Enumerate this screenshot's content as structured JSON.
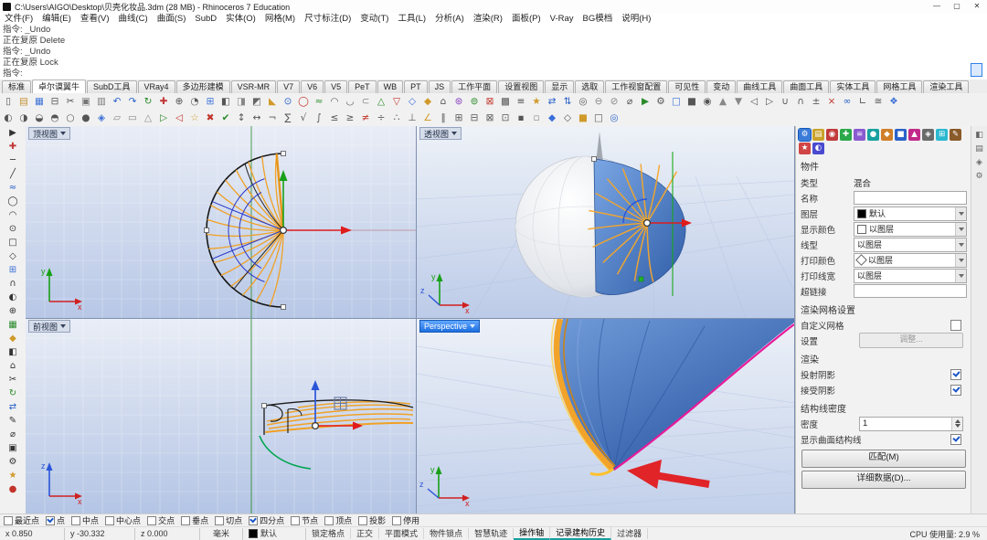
{
  "window": {
    "title": "C:\\Users\\AIGO\\Desktop\\贝壳化妆品.3dm (28 MB) - Rhinoceros 7 Education",
    "controls": {
      "minimize": "—",
      "maximize": "▢",
      "close": "✕"
    }
  },
  "menu": {
    "items": [
      "文件(F)",
      "编辑(E)",
      "查看(V)",
      "曲线(C)",
      "曲面(S)",
      "SubD",
      "实体(O)",
      "网格(M)",
      "尺寸标注(D)",
      "变动(T)",
      "工具(L)",
      "分析(A)",
      "渲染(R)",
      "面板(P)",
      "V-Ray",
      "BG模档",
      "说明(H)"
    ]
  },
  "command": {
    "lines": [
      "指令: _Undo",
      "正在复原 Delete",
      "指令: _Undo",
      "正在复原 Lock",
      "指令:"
    ]
  },
  "tabs": {
    "items": [
      {
        "label": "标准"
      },
      {
        "label": "卓尔谟翼牛",
        "active": true
      },
      {
        "label": "SubD工具"
      },
      {
        "label": "VRay4"
      },
      {
        "label": "多边形建模"
      },
      {
        "label": "VSR-MR"
      },
      {
        "label": "V7"
      },
      {
        "label": "V6"
      },
      {
        "label": "V5"
      },
      {
        "label": "PeT"
      },
      {
        "label": "WB"
      },
      {
        "label": "PT"
      },
      {
        "label": "JS"
      },
      {
        "label": "工作平面"
      },
      {
        "label": "设置视图"
      },
      {
        "label": "显示"
      },
      {
        "label": "选取"
      },
      {
        "label": "工作视窗配置"
      },
      {
        "label": "可见性"
      },
      {
        "label": "变动"
      },
      {
        "label": "曲线工具"
      },
      {
        "label": "曲面工具"
      },
      {
        "label": "实体工具"
      },
      {
        "label": "网格工具"
      },
      {
        "label": "渲染工具"
      }
    ]
  },
  "toolbar": {
    "row1": [
      {
        "g": "▯",
        "c": "#555"
      },
      {
        "g": "▤",
        "c": "#c08a2a"
      },
      {
        "g": "▦",
        "c": "#3a6fd8"
      },
      {
        "g": "⊟",
        "c": "#555"
      },
      {
        "g": "✂",
        "c": "#555"
      },
      {
        "g": "▣",
        "c": "#777"
      },
      {
        "g": "▥",
        "c": "#777"
      },
      {
        "g": "↶",
        "c": "#2a62c9"
      },
      {
        "g": "↷",
        "c": "#2a62c9"
      },
      {
        "g": "↻",
        "c": "#2a8a2a"
      },
      {
        "g": "✚",
        "c": "#c23a3a"
      },
      {
        "g": "⊕",
        "c": "#555"
      },
      {
        "g": "◔",
        "c": "#555"
      },
      {
        "g": "⊞",
        "c": "#3a6fd8"
      },
      {
        "g": "◧",
        "c": "#555"
      },
      {
        "g": "◨",
        "c": "#888"
      },
      {
        "g": "◩",
        "c": "#666"
      },
      {
        "g": "◣",
        "c": "#d09a2a"
      },
      {
        "g": "⊙",
        "c": "#2a62c9"
      },
      {
        "g": "◯",
        "c": "#c2342a"
      },
      {
        "g": "≈",
        "c": "#2a8a2a"
      },
      {
        "g": "◠",
        "c": "#555"
      },
      {
        "g": "◡",
        "c": "#555"
      },
      {
        "g": "⊂",
        "c": "#888"
      },
      {
        "g": "△",
        "c": "#2a8a2a"
      },
      {
        "g": "▽",
        "c": "#c2342a"
      },
      {
        "g": "◇",
        "c": "#3a6fd8"
      },
      {
        "g": "◆",
        "c": "#d09a2a"
      },
      {
        "g": "⌂",
        "c": "#555"
      },
      {
        "g": "⊛",
        "c": "#8a44c0"
      },
      {
        "g": "⊚",
        "c": "#2a8a2a"
      },
      {
        "g": "⊠",
        "c": "#c2342a"
      },
      {
        "g": "▩",
        "c": "#555"
      },
      {
        "g": "≡",
        "c": "#555"
      },
      {
        "g": "★",
        "c": "#d09a2a"
      },
      {
        "g": "⇄",
        "c": "#2a62c9"
      },
      {
        "g": "⇅",
        "c": "#2a62c9"
      },
      {
        "g": "◎",
        "c": "#555"
      },
      {
        "g": "⊖",
        "c": "#888"
      },
      {
        "g": "⊘",
        "c": "#888"
      },
      {
        "g": "⌀",
        "c": "#555"
      },
      {
        "g": "▶",
        "c": "#2a8a2a"
      },
      {
        "g": "⚙",
        "c": "#555"
      },
      {
        "g": "□",
        "c": "#3a6fd8"
      },
      {
        "g": "■",
        "c": "#555"
      },
      {
        "g": "◉",
        "c": "#555"
      },
      {
        "g": "▲",
        "c": "#888"
      },
      {
        "g": "▼",
        "c": "#888"
      },
      {
        "g": "◁",
        "c": "#555"
      },
      {
        "g": "▷",
        "c": "#555"
      },
      {
        "g": "∪",
        "c": "#555"
      },
      {
        "g": "∩",
        "c": "#555"
      },
      {
        "g": "±",
        "c": "#555"
      },
      {
        "g": "×",
        "c": "#c2342a"
      },
      {
        "g": "∞",
        "c": "#2a62c9"
      },
      {
        "g": "∟",
        "c": "#555"
      },
      {
        "g": "≅",
        "c": "#555"
      },
      {
        "g": "❖",
        "c": "#3a6fd8"
      }
    ],
    "row2": [
      {
        "g": "◐",
        "c": "#555"
      },
      {
        "g": "◑",
        "c": "#555"
      },
      {
        "g": "◒",
        "c": "#555"
      },
      {
        "g": "◓",
        "c": "#555"
      },
      {
        "g": "○",
        "c": "#555"
      },
      {
        "g": "●",
        "c": "#555"
      },
      {
        "g": "◈",
        "c": "#3a6fd8"
      },
      {
        "g": "▱",
        "c": "#888"
      },
      {
        "g": "▭",
        "c": "#888"
      },
      {
        "g": "△",
        "c": "#888"
      },
      {
        "g": "▷",
        "c": "#2a8a2a"
      },
      {
        "g": "◁",
        "c": "#c2342a"
      },
      {
        "g": "☆",
        "c": "#d09a2a"
      },
      {
        "g": "✖",
        "c": "#c2342a"
      },
      {
        "g": "✔",
        "c": "#2a8a2a"
      },
      {
        "g": "↕",
        "c": "#555"
      },
      {
        "g": "↔",
        "c": "#555"
      },
      {
        "g": "¬",
        "c": "#555"
      },
      {
        "g": "∑",
        "c": "#555"
      },
      {
        "g": "√",
        "c": "#555"
      },
      {
        "g": "∫",
        "c": "#555"
      },
      {
        "g": "≤",
        "c": "#555"
      },
      {
        "g": "≥",
        "c": "#555"
      },
      {
        "g": "≠",
        "c": "#c2342a"
      },
      {
        "g": "÷",
        "c": "#555"
      },
      {
        "g": "∴",
        "c": "#555"
      },
      {
        "g": "⊥",
        "c": "#555"
      },
      {
        "g": "∠",
        "c": "#d09a2a"
      },
      {
        "g": "∥",
        "c": "#555"
      },
      {
        "g": "⊞",
        "c": "#555"
      },
      {
        "g": "⊟",
        "c": "#555"
      },
      {
        "g": "⊠",
        "c": "#555"
      },
      {
        "g": "⊡",
        "c": "#555"
      },
      {
        "g": "▪",
        "c": "#555"
      },
      {
        "g": "▫",
        "c": "#888"
      },
      {
        "g": "◆",
        "c": "#3a6fd8"
      },
      {
        "g": "◇",
        "c": "#555"
      },
      {
        "g": "■",
        "c": "#d09a2a"
      },
      {
        "g": "□",
        "c": "#555"
      },
      {
        "g": "◎",
        "c": "#2a62c9"
      }
    ]
  },
  "leftbar": {
    "icons": [
      {
        "g": "▶",
        "c": "#333"
      },
      {
        "g": "✚",
        "c": "#c23a3a"
      },
      {
        "g": "─",
        "c": "#333"
      },
      {
        "g": "╱",
        "c": "#333"
      },
      {
        "g": "≈",
        "c": "#2a62c9"
      },
      {
        "g": "◯",
        "c": "#333"
      },
      {
        "g": "◠",
        "c": "#333"
      },
      {
        "g": "⊙",
        "c": "#333"
      },
      {
        "g": "□",
        "c": "#333"
      },
      {
        "g": "◇",
        "c": "#333"
      },
      {
        "g": "⊞",
        "c": "#3a6fd8"
      },
      {
        "g": "∩",
        "c": "#333"
      },
      {
        "g": "◐",
        "c": "#333"
      },
      {
        "g": "⊕",
        "c": "#333"
      },
      {
        "g": "▦",
        "c": "#2a8a2a"
      },
      {
        "g": "◆",
        "c": "#d09a2a"
      },
      {
        "g": "◧",
        "c": "#333"
      },
      {
        "g": "⌂",
        "c": "#333"
      },
      {
        "g": "✂",
        "c": "#333"
      },
      {
        "g": "↻",
        "c": "#2a8a2a"
      },
      {
        "g": "⇄",
        "c": "#2a62c9"
      },
      {
        "g": "✎",
        "c": "#333"
      },
      {
        "g": "⌀",
        "c": "#333"
      },
      {
        "g": "▣",
        "c": "#333"
      },
      {
        "g": "⚙",
        "c": "#333"
      },
      {
        "g": "★",
        "c": "#d09a2a"
      },
      {
        "g": "●",
        "c": "#c2342a"
      }
    ]
  },
  "viewports": {
    "top_left": {
      "label": "顶视图"
    },
    "top_right": {
      "label": "透视图"
    },
    "bottom_left": {
      "label": "前视图"
    },
    "bottom_right": {
      "label": "Perspective"
    }
  },
  "axes": {
    "x": "x",
    "y": "y",
    "z": "z"
  },
  "panel": {
    "tabs": [
      {
        "g": "⚙",
        "b": "#3a7bd8",
        "a": true
      },
      {
        "g": "▤",
        "b": "#caa22a"
      },
      {
        "g": "◉",
        "b": "#c23a3a"
      },
      {
        "g": "✚",
        "b": "#2aa84a"
      },
      {
        "g": "≡",
        "b": "#8a5ad0"
      },
      {
        "g": "●",
        "b": "#18a0a0"
      },
      {
        "g": "◆",
        "b": "#d07f2a"
      },
      {
        "g": "■",
        "b": "#2a62c9"
      },
      {
        "g": "▲",
        "b": "#c22a8a"
      },
      {
        "g": "◈",
        "b": "#6a6a6a"
      },
      {
        "g": "⊞",
        "b": "#2ab8d0"
      },
      {
        "g": "✎",
        "b": "#8a5a2a"
      },
      {
        "g": "★",
        "b": "#d04545"
      },
      {
        "g": "◐",
        "b": "#4a4ad0"
      }
    ],
    "object_header": "物件",
    "type": {
      "label": "类型",
      "value": "混合"
    },
    "name": {
      "label": "名称",
      "value": ""
    },
    "layer": {
      "label": "图层",
      "value": "默认"
    },
    "display_color": {
      "label": "显示颜色",
      "value": "以图层"
    },
    "linetype": {
      "label": "线型",
      "value": "以图层"
    },
    "print_color": {
      "label": "打印颜色",
      "value": "以图层"
    },
    "print_width": {
      "label": "打印线宽",
      "value": "以图层"
    },
    "hyperlink": {
      "label": "超链接",
      "value": ""
    },
    "render_mesh_header": "渲染网格设置",
    "custom_mesh": {
      "label": "自定义网格",
      "checked": false
    },
    "settings": {
      "label": "设置",
      "button": "调整..."
    },
    "render_header": "渲染",
    "cast_shadows": {
      "label": "投射阴影",
      "checked": true
    },
    "receive_shadows": {
      "label": "接受阴影",
      "checked": true
    },
    "isocurve_header": "结构线密度",
    "density": {
      "label": "密度",
      "value": "1"
    },
    "show_isocurves": {
      "label": "显示曲面结构线",
      "checked": true
    },
    "match_button": "匹配(M)",
    "details_button": "详细数据(D)..."
  },
  "rightstrip": {
    "icons": [
      {
        "g": "◧",
        "c": "#666"
      },
      {
        "g": "▤",
        "c": "#666"
      },
      {
        "g": "◈",
        "c": "#666"
      },
      {
        "g": "⚙",
        "c": "#666"
      }
    ]
  },
  "statusbar": {
    "osnaps": [
      {
        "label": "最近点",
        "checked": false
      },
      {
        "label": "点",
        "checked": true
      },
      {
        "label": "中点",
        "checked": false
      },
      {
        "label": "中心点",
        "checked": false
      },
      {
        "label": "交点",
        "checked": false
      },
      {
        "label": "垂点",
        "checked": false
      },
      {
        "label": "切点",
        "checked": false
      },
      {
        "label": "四分点",
        "checked": true
      },
      {
        "label": "节点",
        "checked": false
      },
      {
        "label": "顶点",
        "checked": false
      },
      {
        "label": "投影",
        "checked": false
      },
      {
        "label": "停用",
        "checked": false
      }
    ],
    "coords": {
      "x": "x 0.850",
      "y": "y -30.332",
      "z": "z 0.000"
    },
    "units": "毫米",
    "layer": "默认",
    "toggles": [
      {
        "label": "锁定格点",
        "active": false
      },
      {
        "label": "正交",
        "active": false
      },
      {
        "label": "平面模式",
        "active": false
      },
      {
        "label": "物件锁点",
        "active": false
      },
      {
        "label": "智慧轨迹",
        "active": false
      },
      {
        "label": "操作轴",
        "active": true
      },
      {
        "label": "记录建构历史",
        "active": true
      },
      {
        "label": "过滤器",
        "active": false
      }
    ],
    "cpu": "CPU 使用量: 2.9 %"
  },
  "colors": {
    "accent_blue": "#2f80e8",
    "curve_orange": "#f2a32a",
    "surface_blue": "#2e5ca6",
    "edge_magenta": "#e8199a",
    "annotation_red": "#e02428"
  }
}
